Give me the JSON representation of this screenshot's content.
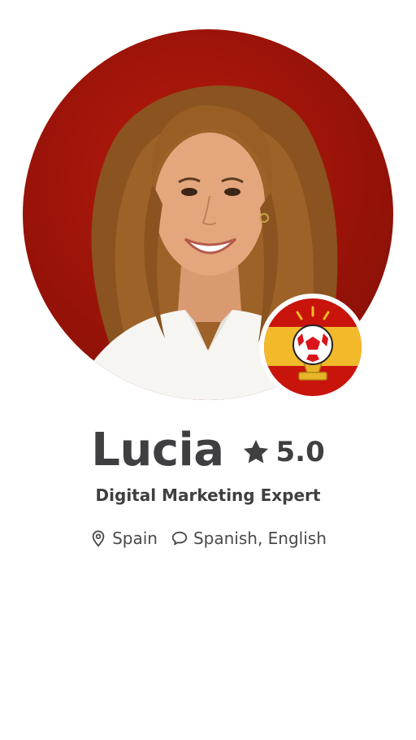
{
  "profile": {
    "name": "Lucia",
    "rating": "5.0",
    "title": "Digital Marketing Expert",
    "location": "Spain",
    "languages": "Spanish, English"
  },
  "icons": {
    "rating": "star-icon",
    "location": "map-pin-icon",
    "languages": "speech-bubble-icon",
    "badge": "spain-football-trophy-icon"
  },
  "colors": {
    "background": "#ffffff",
    "photo_background": "#9e1409",
    "text": "#3f3f41",
    "badge_red": "#c8140b",
    "badge_yellow": "#f2b92b"
  }
}
